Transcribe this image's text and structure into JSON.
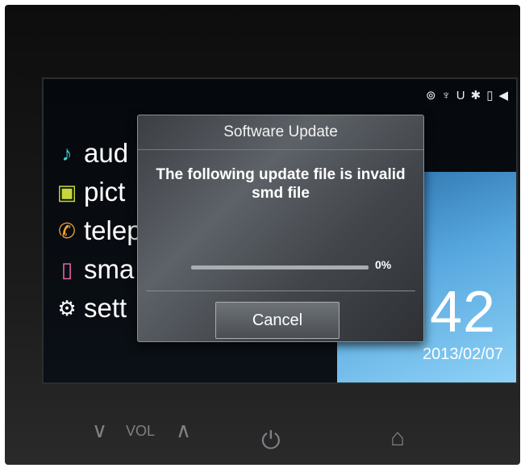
{
  "status_icons": [
    {
      "name": "onstar-icon",
      "glyph": "⊚"
    },
    {
      "name": "usb-plug-icon",
      "glyph": "♆"
    },
    {
      "name": "usb-u-icon",
      "glyph": "U"
    },
    {
      "name": "bluetooth-icon",
      "glyph": "✱"
    },
    {
      "name": "phone-battery-icon",
      "glyph": "▯"
    },
    {
      "name": "speaker-mute-icon",
      "glyph": "◀"
    }
  ],
  "menu": {
    "items": [
      {
        "label": "aud",
        "icon": "♪",
        "icon_color": "#3fd3d6"
      },
      {
        "label": "pict",
        "icon": "▣",
        "icon_color": "#c8d83a"
      },
      {
        "label": "telep",
        "icon": "✆",
        "icon_color": "#f4a52c"
      },
      {
        "label": "sma",
        "icon": "▯",
        "icon_color": "#f06ab0"
      },
      {
        "label": "sett",
        "icon": "⚙",
        "icon_color": "#ffffff"
      }
    ]
  },
  "clock": {
    "time": ":42",
    "date": "2013/02/07"
  },
  "dialog": {
    "title": "Software Update",
    "message_line1": "The following update file is invalid",
    "message_line2": "smd file",
    "progress_value": 0,
    "progress_text": "0%",
    "cancel_label": "Cancel"
  },
  "controls": {
    "vol_down": "∨",
    "vol_label": "VOL",
    "vol_up": "∧",
    "power": "⏻",
    "home": "⌂"
  }
}
